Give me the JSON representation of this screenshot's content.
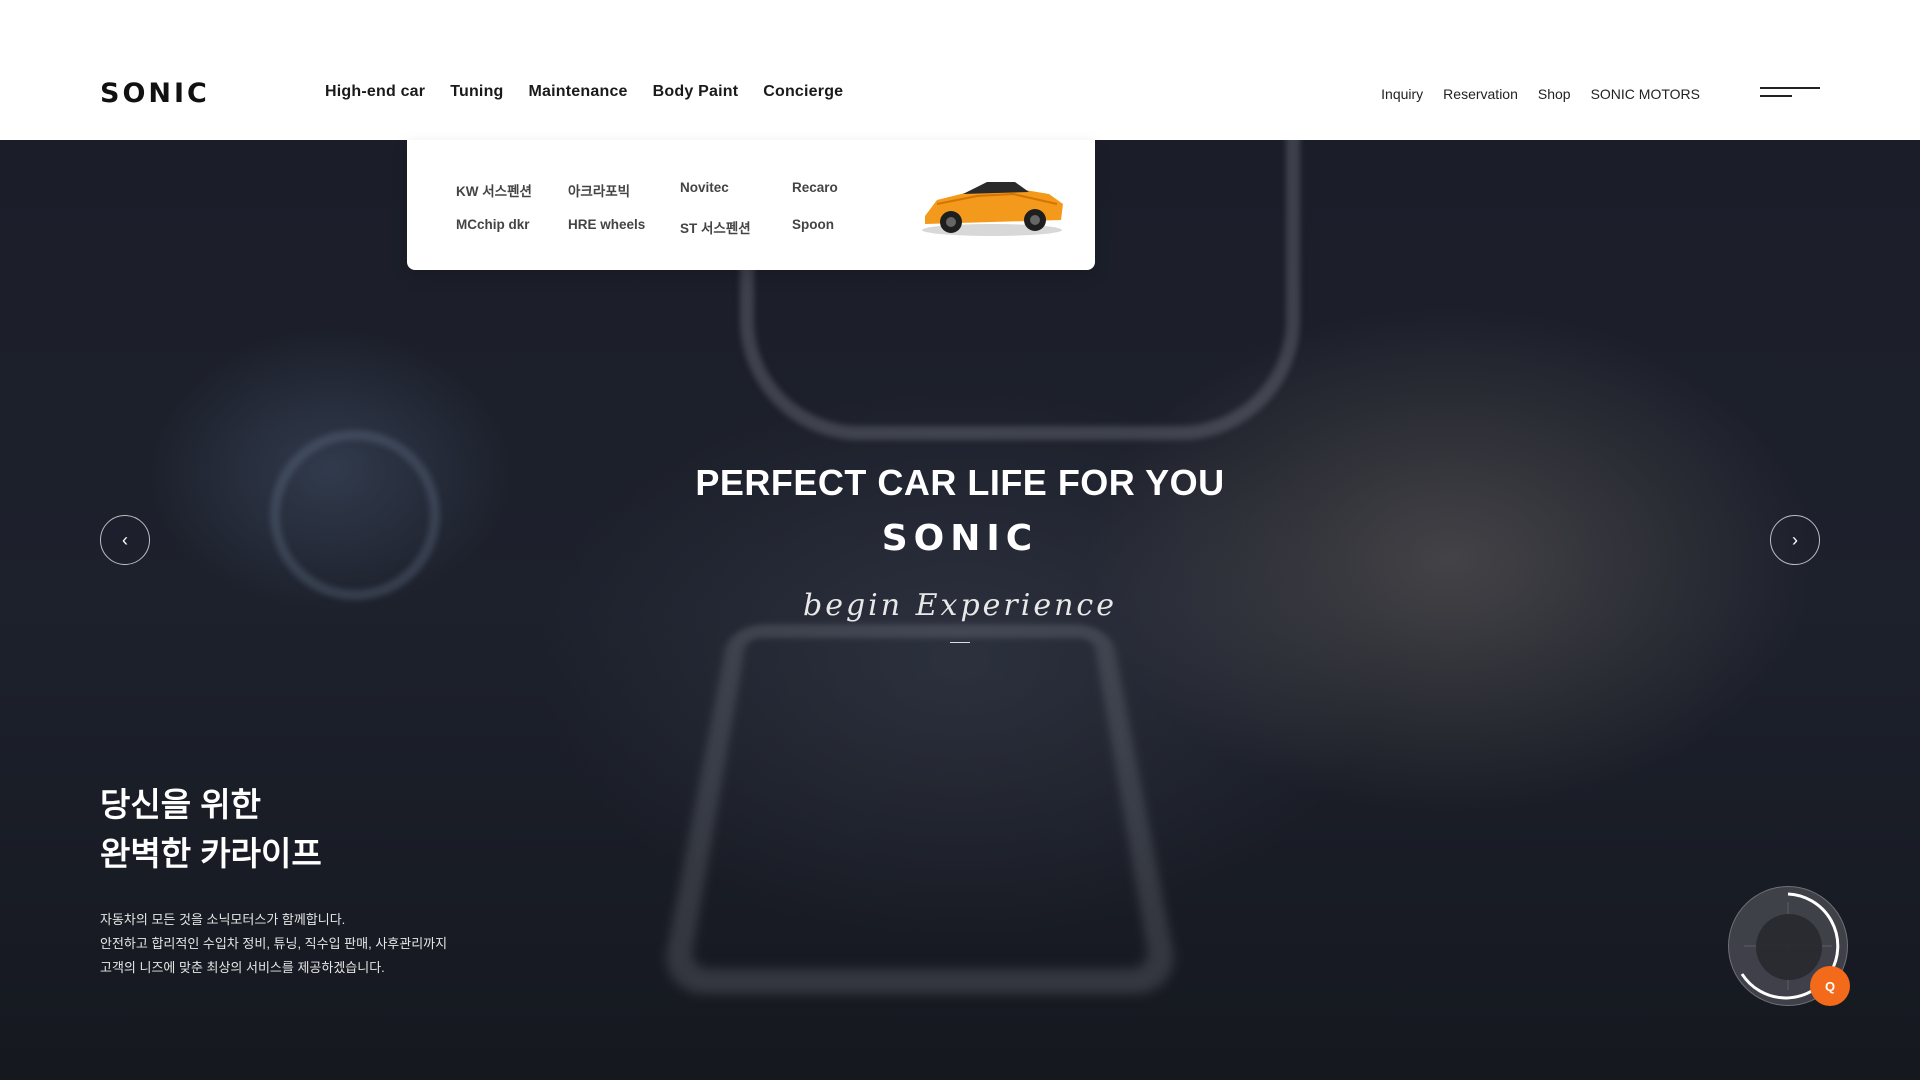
{
  "header": {
    "logo": "SONIC",
    "gnb": [
      "High-end car",
      "Tuning",
      "Maintenance",
      "Body Paint",
      "Concierge"
    ],
    "active_gnb": "Tuning",
    "util": [
      "Inquiry",
      "Reservation",
      "Shop",
      "SONIC MOTORS"
    ]
  },
  "dropdown": {
    "links": [
      "KW 서스펜션",
      "아크라포빅",
      "Novitec",
      "Recaro",
      "MCchip dkr",
      "HRE wheels",
      "ST 서스펜션",
      "Spoon"
    ],
    "image": "orange-sports-car"
  },
  "hero": {
    "title": "PERFECT CAR LIFE FOR YOU",
    "brand": "SONIC",
    "script": "begin Experience",
    "prev_icon": "chevron-left-icon",
    "next_icon": "chevron-right-icon",
    "prev_glyph": "‹",
    "next_glyph": "›",
    "headline": [
      "당신을 위한",
      "완벽한 카라이프"
    ],
    "description": [
      "자동차의 모든 것을 소닉모터스가 함께합니다.",
      "안전하고 합리적인 수입차 정비, 튜닝, 직수입 판매, 사후관리까지",
      "고객의 니즈에 맞춘 최상의 서비스를 제공하겠습니다."
    ]
  },
  "widget": {
    "badge": "Q"
  },
  "colors": {
    "accent": "#f36a1b",
    "header_bg": "#ffffff",
    "hero_bg": "#1b1e29"
  }
}
